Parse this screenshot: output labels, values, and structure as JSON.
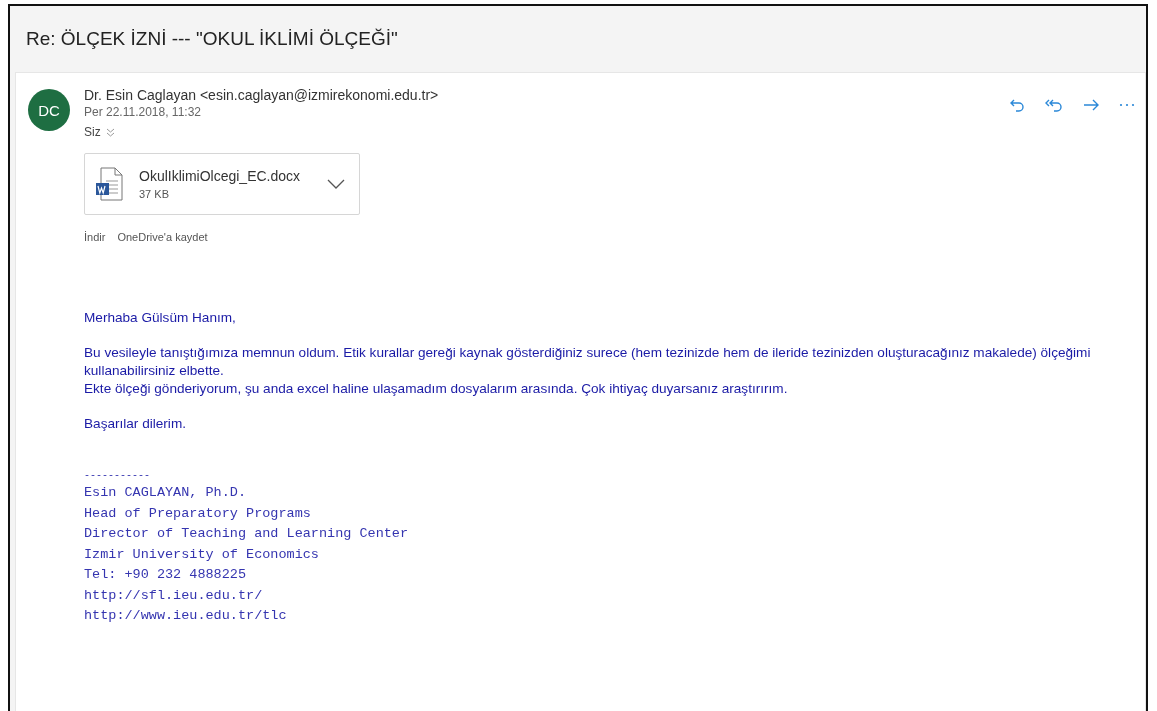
{
  "subject": "Re: ÖLÇEK İZNİ --- \"OKUL İKLİMİ ÖLÇEĞİ\"",
  "message": {
    "avatar_initials": "DC",
    "sender": "Dr. Esin Caglayan <esin.caglayan@izmirekonomi.edu.tr>",
    "date": "Per 22.11.2018, 11:32",
    "recipient": "Siz",
    "attachment": {
      "name": "OkulIklimiOlcegi_EC.docx",
      "size": "37 KB"
    },
    "attachment_actions": [
      "İndir",
      "OneDrive'a kaydet"
    ],
    "body": [
      [
        "Merhaba Gülsüm Hanım,"
      ],
      [
        "Bu vesileyle tanıştığımıza memnun oldum. Etik kurallar gereği kaynak gösterdiğiniz surece (hem tezinizde hem de ileride tezinizden oluşturacağınız makalede) ölçeğimi kullanabilirsiniz elbette.",
        "Ekte ölçeği gönderiyorum, şu anda excel haline ulaşamadım dosyalarım arasında. Çok ihtiyaç duyarsanız araştırırım."
      ],
      [
        "Başarılar dilerim."
      ]
    ],
    "signature": [
      "-----------",
      "Esin CAGLAYAN, Ph.D.",
      "Head of Preparatory Programs",
      "Director of Teaching and Learning Center",
      "Izmir University of Economics",
      "Tel: +90 232 4888225",
      "http://sfl.ieu.edu.tr/",
      "http://www.ieu.edu.tr/tlc"
    ]
  }
}
